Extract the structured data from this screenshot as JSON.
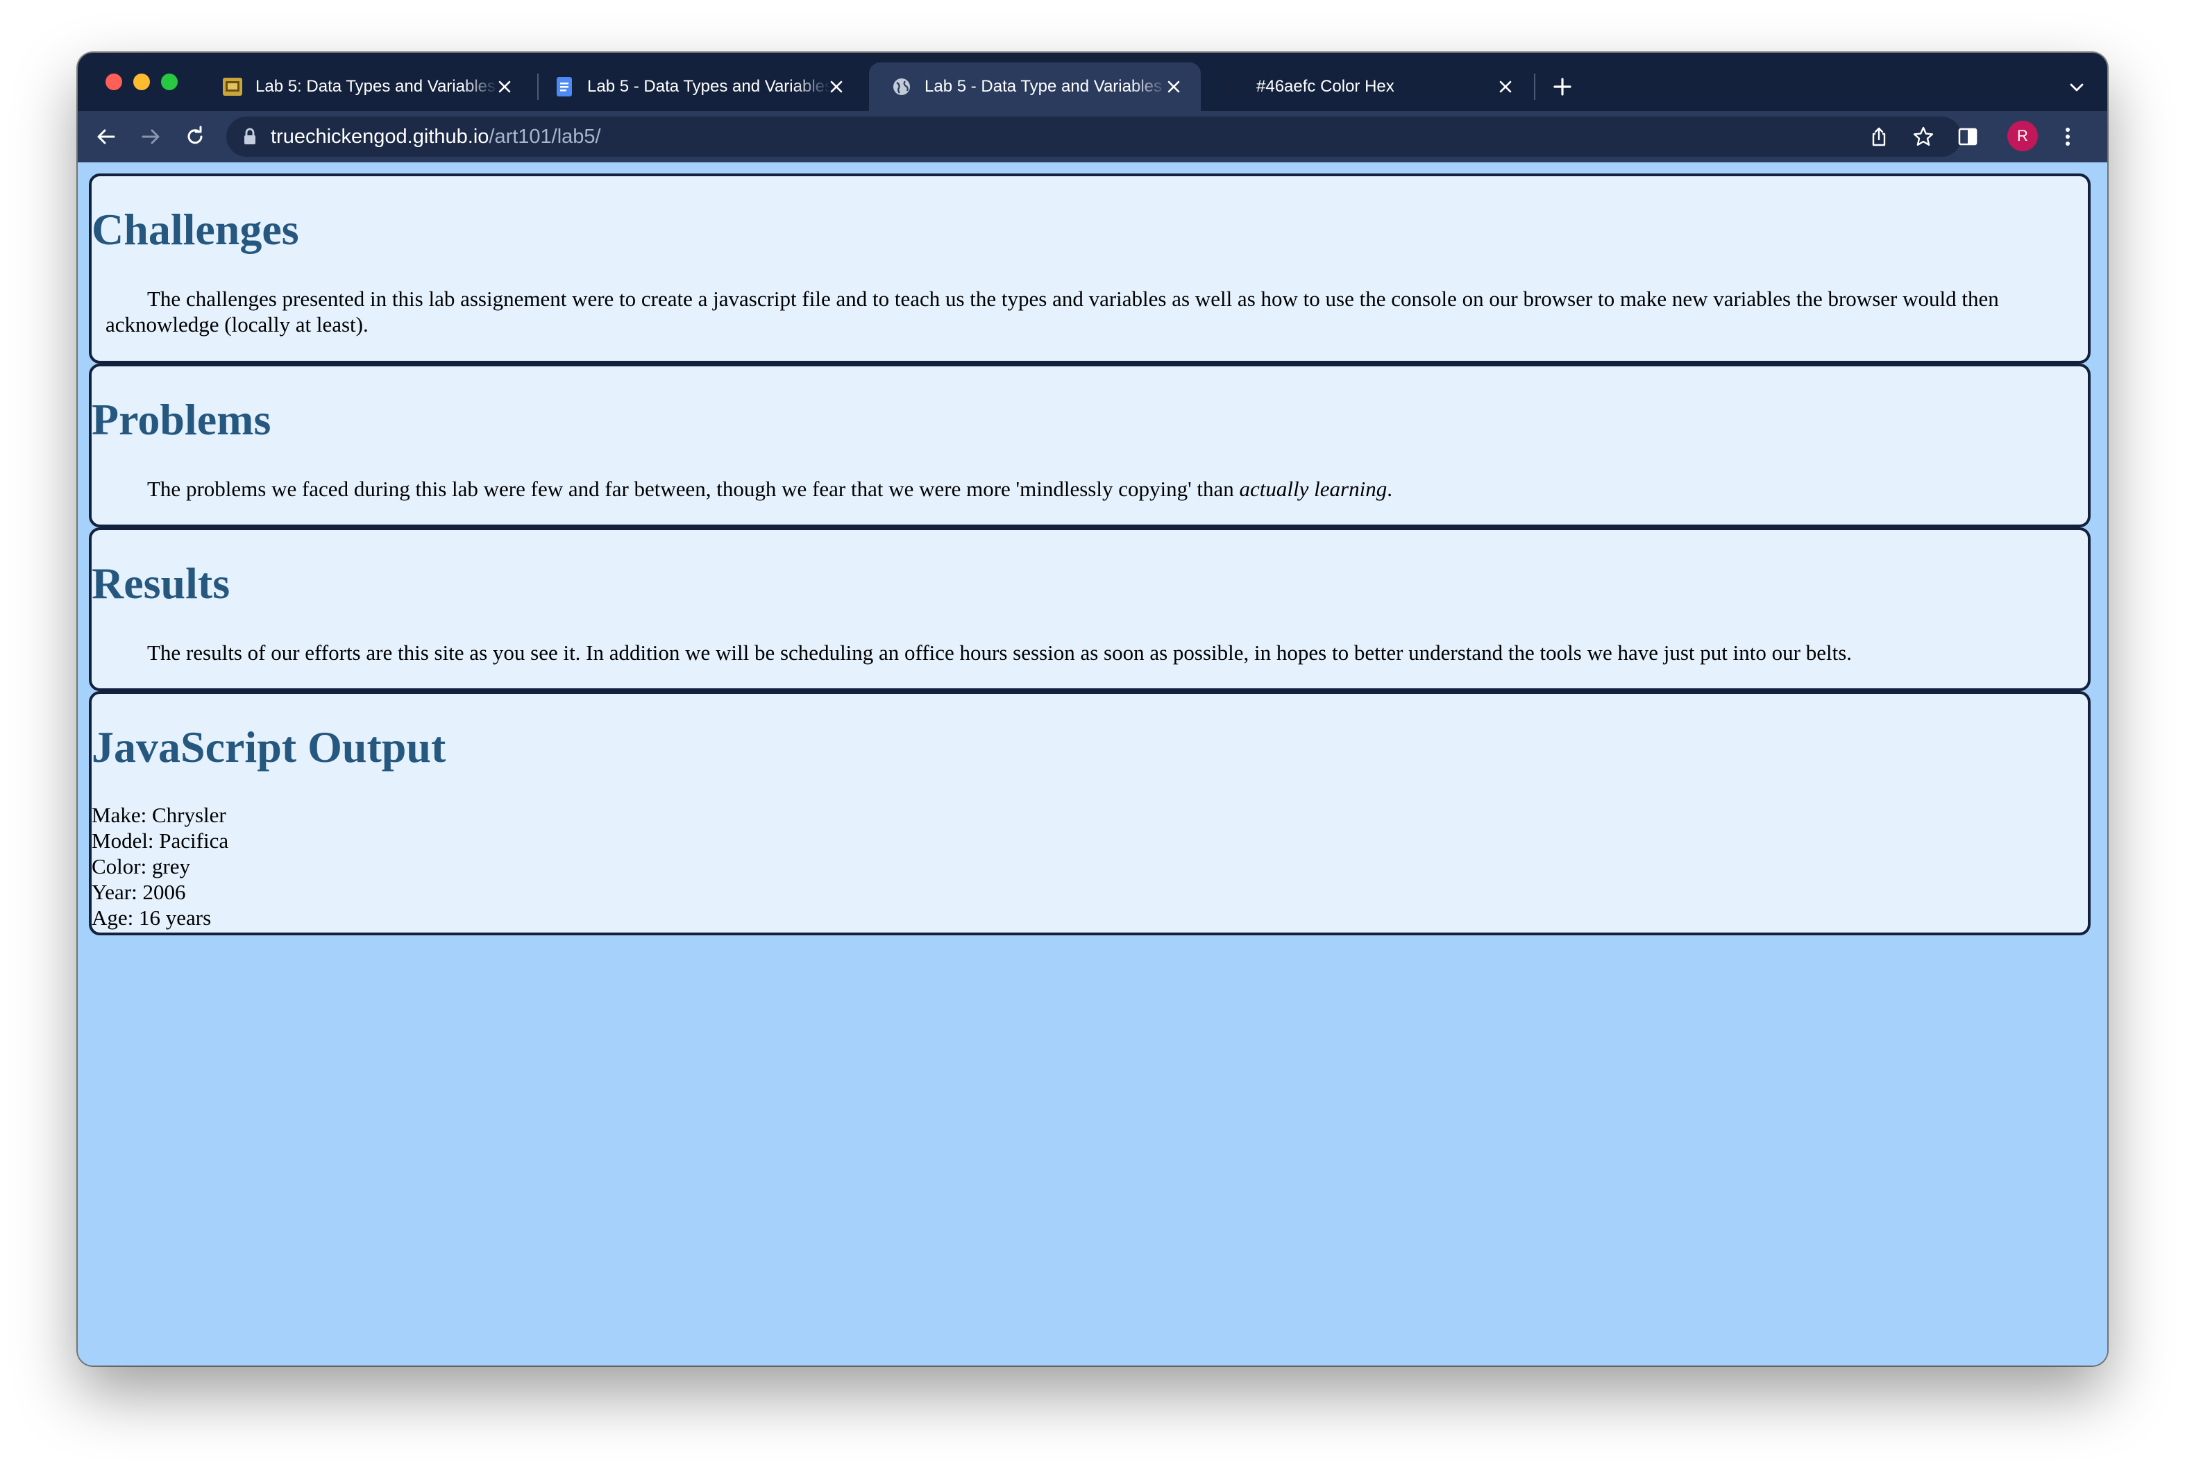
{
  "browser": {
    "tabs": [
      {
        "title": "Lab 5: Data Types and Variables",
        "favicon": "lab-logo-icon",
        "active": false
      },
      {
        "title": "Lab 5 - Data Types and Variables",
        "favicon": "docs-icon",
        "active": false
      },
      {
        "title": "Lab 5 - Data Type and Variables",
        "favicon": "globe-icon",
        "active": true
      },
      {
        "title": "#46aefc Color Hex",
        "favicon": "colorhex-icon",
        "active": false
      }
    ],
    "url_host": "truechickengod.github.io",
    "url_path": "/art101/lab5/",
    "profile_initial": "R"
  },
  "colors": {
    "page_background": "#a6d1fa",
    "section_background": "#e5f2fe",
    "heading": "#26577f",
    "border": "#13213d",
    "tabstrip": "#13213d",
    "toolbar": "#2a3b5e"
  },
  "page": {
    "challenges": {
      "heading": "Challenges",
      "text": "The challenges presented in this lab assignement were to create a javascript file and to teach us the types and variables as well as how to use the console on our browser to make new variables the browser would then acknowledge (locally at least)."
    },
    "problems": {
      "heading": "Problems",
      "text_before": "The problems we faced during this lab were few and far between, though we fear that we were more 'mindlessly copying' than ",
      "text_emphasis": "actually learning",
      "text_after": "."
    },
    "results": {
      "heading": "Results",
      "text": "The results of our efforts are this site as you see it. In addition we will be scheduling an office hours session as soon as possible, in hopes to better understand the tools we have just put into our belts."
    },
    "output": {
      "heading": "JavaScript Output",
      "lines": [
        "Make: Chrysler",
        "Model: Pacifica",
        "Color: grey",
        "Year: 2006",
        "Age: 16 years"
      ]
    }
  }
}
